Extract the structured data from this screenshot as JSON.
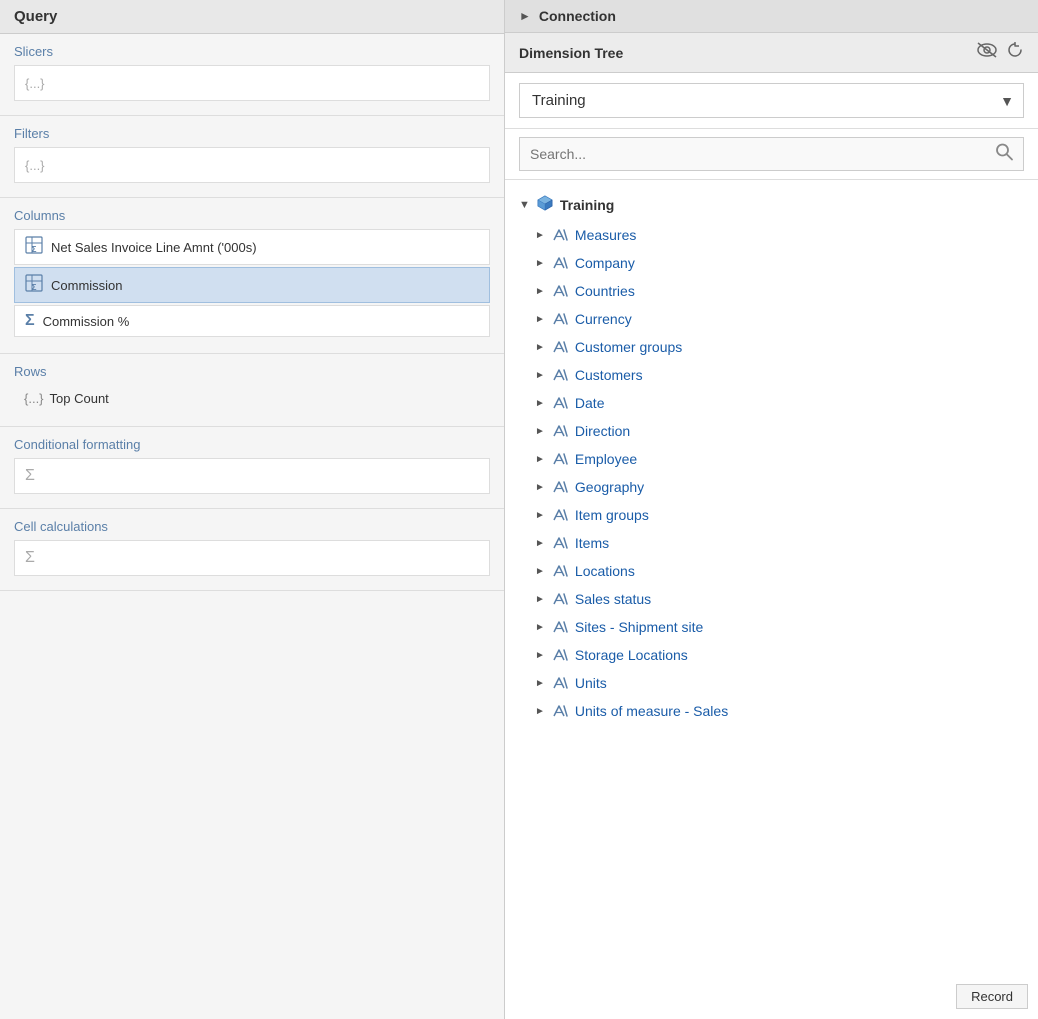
{
  "left": {
    "title": "Query",
    "slicers": {
      "label": "Slicers",
      "placeholder": "{...}"
    },
    "filters": {
      "label": "Filters",
      "placeholder": "{...}"
    },
    "columns": {
      "label": "Columns",
      "items": [
        {
          "id": 1,
          "label": "Net Sales Invoice Line Amnt ('000s)",
          "icon": "sigma-table",
          "selected": false
        },
        {
          "id": 2,
          "label": "Commission",
          "icon": "sigma-table",
          "selected": true
        },
        {
          "id": 3,
          "label": "Commission %",
          "icon": "sigma",
          "selected": false
        }
      ]
    },
    "rows": {
      "label": "Rows",
      "item": "{...} Top Count"
    },
    "conditional_formatting": {
      "label": "Conditional formatting",
      "placeholder": "Σ"
    },
    "cell_calculations": {
      "label": "Cell calculations",
      "placeholder": "Σ"
    }
  },
  "right": {
    "connection_label": "Connection",
    "dim_tree_label": "Dimension Tree",
    "dropdown": {
      "selected": "Training",
      "options": [
        "Training"
      ]
    },
    "search": {
      "placeholder": "Search..."
    },
    "tree": {
      "root": "Training",
      "items": [
        {
          "id": 1,
          "label": "Measures"
        },
        {
          "id": 2,
          "label": "Company"
        },
        {
          "id": 3,
          "label": "Countries"
        },
        {
          "id": 4,
          "label": "Currency"
        },
        {
          "id": 5,
          "label": "Customer groups"
        },
        {
          "id": 6,
          "label": "Customers"
        },
        {
          "id": 7,
          "label": "Date"
        },
        {
          "id": 8,
          "label": "Direction"
        },
        {
          "id": 9,
          "label": "Employee"
        },
        {
          "id": 10,
          "label": "Geography"
        },
        {
          "id": 11,
          "label": "Item groups"
        },
        {
          "id": 12,
          "label": "Items"
        },
        {
          "id": 13,
          "label": "Locations"
        },
        {
          "id": 14,
          "label": "Sales status"
        },
        {
          "id": 15,
          "label": "Sites - Shipment site"
        },
        {
          "id": 16,
          "label": "Storage Locations"
        },
        {
          "id": 17,
          "label": "Units"
        },
        {
          "id": 18,
          "label": "Units of measure - Sales"
        }
      ]
    },
    "record_button": "Record"
  }
}
